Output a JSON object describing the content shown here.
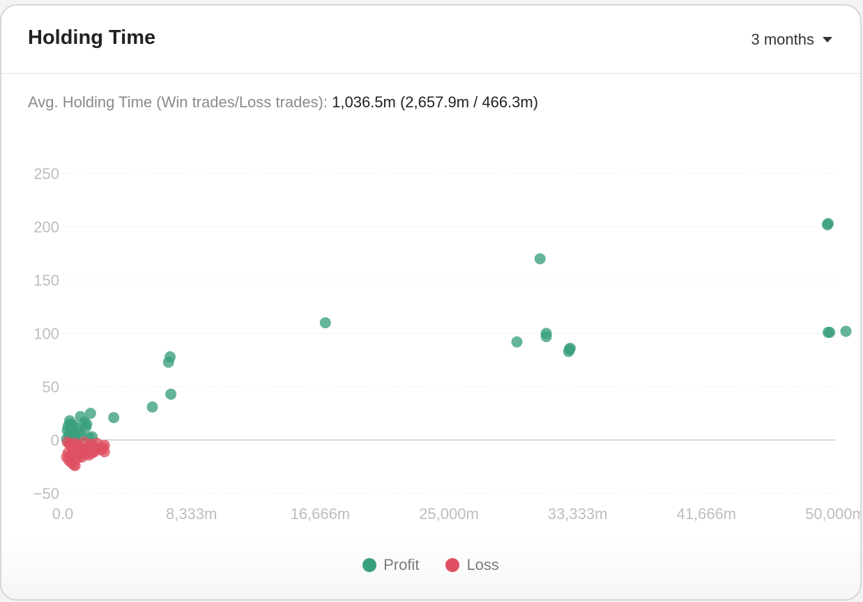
{
  "header": {
    "title": "Holding Time",
    "range_label": "3 months"
  },
  "summary": {
    "label": "Avg. Holding Time (Win trades/Loss trades):",
    "value": "1,036.5m (2,657.9m / 466.3m)"
  },
  "colors": {
    "profit": "#3a9f7d",
    "loss": "#de5061",
    "grid": "#ececec",
    "tick": "#bdbdbd",
    "zero_line": "#c8c8c8"
  },
  "chart_data": {
    "type": "scatter",
    "x_ticks": [
      "0.0",
      "8,333m",
      "16,666m",
      "25,000m",
      "33,333m",
      "41,666m",
      "50,000m"
    ],
    "y_ticks": [
      "250",
      "200",
      "150",
      "100",
      "50",
      "0",
      "−50"
    ],
    "xlim": [
      0,
      50000
    ],
    "ylim": [
      -50,
      250
    ],
    "grid": true,
    "legend_position": "bottom",
    "series": [
      {
        "name": "Profit",
        "color": "#3a9f7d",
        "points": [
          [
            49500,
            202
          ],
          [
            49550,
            203
          ],
          [
            49550,
            101
          ],
          [
            49650,
            101
          ],
          [
            50700,
            102
          ],
          [
            30900,
            170
          ],
          [
            31300,
            100
          ],
          [
            31300,
            97
          ],
          [
            29400,
            92
          ],
          [
            32800,
            85
          ],
          [
            32850,
            86
          ],
          [
            32750,
            83
          ],
          [
            17000,
            110
          ],
          [
            6950,
            78
          ],
          [
            6850,
            73
          ],
          [
            7000,
            43
          ],
          [
            5800,
            31
          ],
          [
            3300,
            21
          ],
          [
            1800,
            25
          ],
          [
            1150,
            22
          ],
          [
            1400,
            17
          ],
          [
            1500,
            12
          ],
          [
            1550,
            15
          ],
          [
            450,
            18
          ],
          [
            500,
            15
          ],
          [
            350,
            13
          ],
          [
            700,
            14
          ],
          [
            600,
            10
          ],
          [
            900,
            11
          ],
          [
            1100,
            8
          ],
          [
            300,
            9
          ],
          [
            400,
            5
          ],
          [
            800,
            3
          ],
          [
            1200,
            4
          ],
          [
            1700,
            2
          ],
          [
            1900,
            3
          ],
          [
            250,
            1
          ],
          [
            650,
            2
          ]
        ]
      },
      {
        "name": "Loss",
        "color": "#de5061",
        "points": [
          [
            300,
            -2
          ],
          [
            450,
            -4
          ],
          [
            600,
            -6
          ],
          [
            800,
            -3
          ],
          [
            1000,
            -5
          ],
          [
            1200,
            -8
          ],
          [
            1400,
            -2
          ],
          [
            1600,
            -9
          ],
          [
            1800,
            -4
          ],
          [
            2000,
            -6
          ],
          [
            2200,
            -3
          ],
          [
            2500,
            -9
          ],
          [
            2700,
            -5
          ],
          [
            350,
            -12
          ],
          [
            500,
            -15
          ],
          [
            650,
            -10
          ],
          [
            900,
            -12
          ],
          [
            1100,
            -14
          ],
          [
            1300,
            -11
          ],
          [
            1500,
            -13
          ],
          [
            1700,
            -10
          ],
          [
            400,
            -19
          ],
          [
            550,
            -21
          ],
          [
            700,
            -23
          ],
          [
            800,
            -24
          ],
          [
            250,
            -16
          ],
          [
            950,
            -17
          ],
          [
            1250,
            -16
          ],
          [
            1700,
            -14
          ],
          [
            2050,
            -11
          ],
          [
            2300,
            -8
          ],
          [
            2600,
            -7
          ],
          [
            2700,
            -11
          ],
          [
            1900,
            -12
          ]
        ]
      }
    ]
  },
  "legend": {
    "profit_label": "Profit",
    "loss_label": "Loss"
  }
}
